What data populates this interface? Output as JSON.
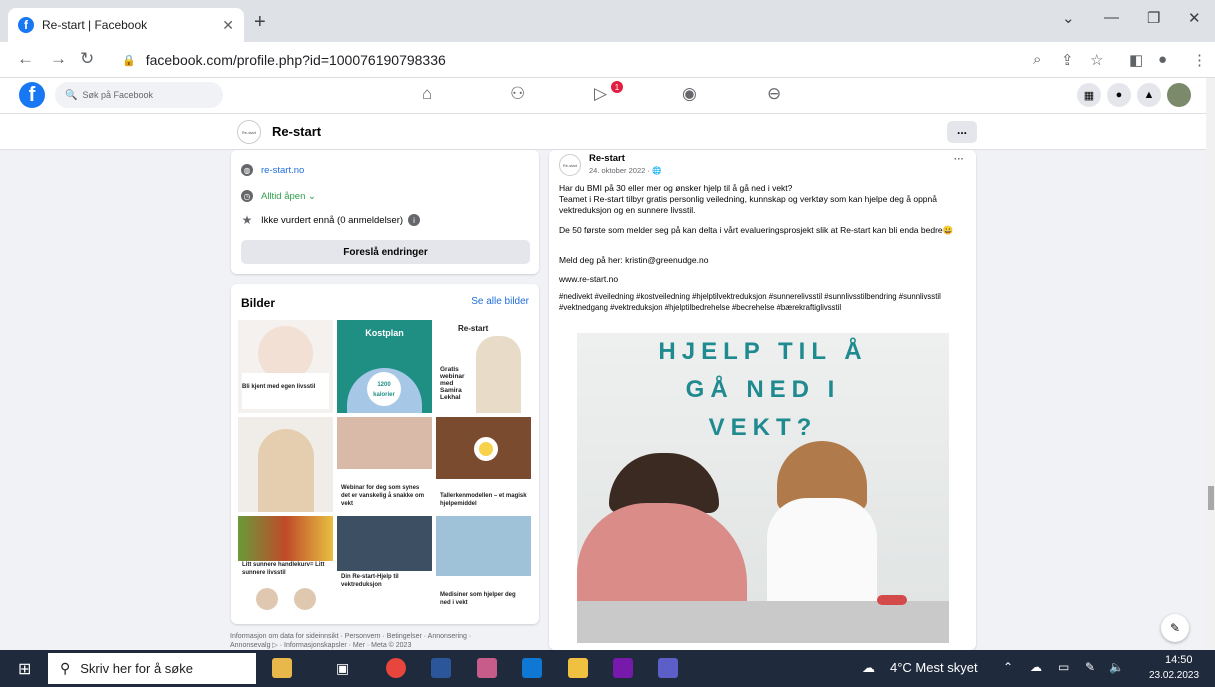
{
  "browser": {
    "tab_title": "Re-start | Facebook",
    "url": "facebook.com/profile.php?id=100076190798336"
  },
  "facebook": {
    "search_placeholder": "Søk på Facebook",
    "video_badge": "1"
  },
  "page": {
    "name": "Re-start",
    "mini_logo": "Re-start",
    "more_label": "..."
  },
  "about": {
    "website": "re-start.no",
    "hours": "Alltid åpen ⌄",
    "rating": "Ikke vurdert ennå (0 anmeldelser)",
    "suggest_button": "Foreslå endringer"
  },
  "photos": {
    "title": "Bilder",
    "see_all": "Se alle bilder",
    "items": [
      {
        "caption": "Bli kjent med egen livsstil"
      },
      {
        "caption": "Kostplan"
      },
      {
        "caption": "Gratis webinar med Samira Lekhal"
      },
      {
        "caption": ""
      },
      {
        "caption": "Webinar for deg som synes det er vanskelig å snakke om vekt"
      },
      {
        "caption": "Tallerkenmodellen – et magisk hjelpemiddel"
      },
      {
        "caption": "Litt sunnere handlekurv= Litt sunnere livsstil"
      },
      {
        "caption": "Din Re-start-Hjelp til vektreduksjon"
      },
      {
        "caption": "Medisiner som hjelper deg ned i vekt"
      }
    ],
    "kostplan_sub": "1200 kalorier",
    "restart_logo": "Re-start"
  },
  "footer": {
    "line1": "Informasjon om data for sideinnsikt · Personvern · Betingelser · Annonsering ·",
    "line2": "Annonsevalg ▷ · Informasjonskapsler · Mer · Meta © 2023"
  },
  "post": {
    "author": "Re-start",
    "date": "24. oktober 2022 · 🌐",
    "menu": "···",
    "p1": "Har du BMI på 30 eller mer og ønsker hjelp til å gå ned i vekt?",
    "p2": "Teamet i Re-start tilbyr gratis personlig veiledning, kunnskap og verktøy som kan hjelpe deg å oppnå vektreduksjon og en sunnere livsstil.",
    "p3": "De 50 første som melder seg på kan delta i vårt evalueringsprosjekt slik at Re-start kan bli enda bedre😀",
    "p4": "Meld deg på her: kristin@greenudge.no",
    "link": "www.re-start.no",
    "hashtags": "#nedivekt #veiledning #kostveiledning #hjelptilvektreduksjon #sunnerelivsstil #sunnlivsstilbendring #sunnlivsstil #vektnedgang #vektreduksjon #hjelptilbedrehelse #becrehelse #bærekraftiglivsstil",
    "image_headline": [
      "HJELP TIL Å",
      "GÅ NED I",
      "VEKT?"
    ]
  },
  "taskbar": {
    "search_placeholder": "Skriv her for å søke",
    "weather": "4°C  Mest skyet",
    "time": "14:50",
    "date": "23.02.2023"
  },
  "colors": {
    "facebook_blue": "#1877f2",
    "headline_teal": "#1f8a8f",
    "link_blue": "#216fdb"
  }
}
